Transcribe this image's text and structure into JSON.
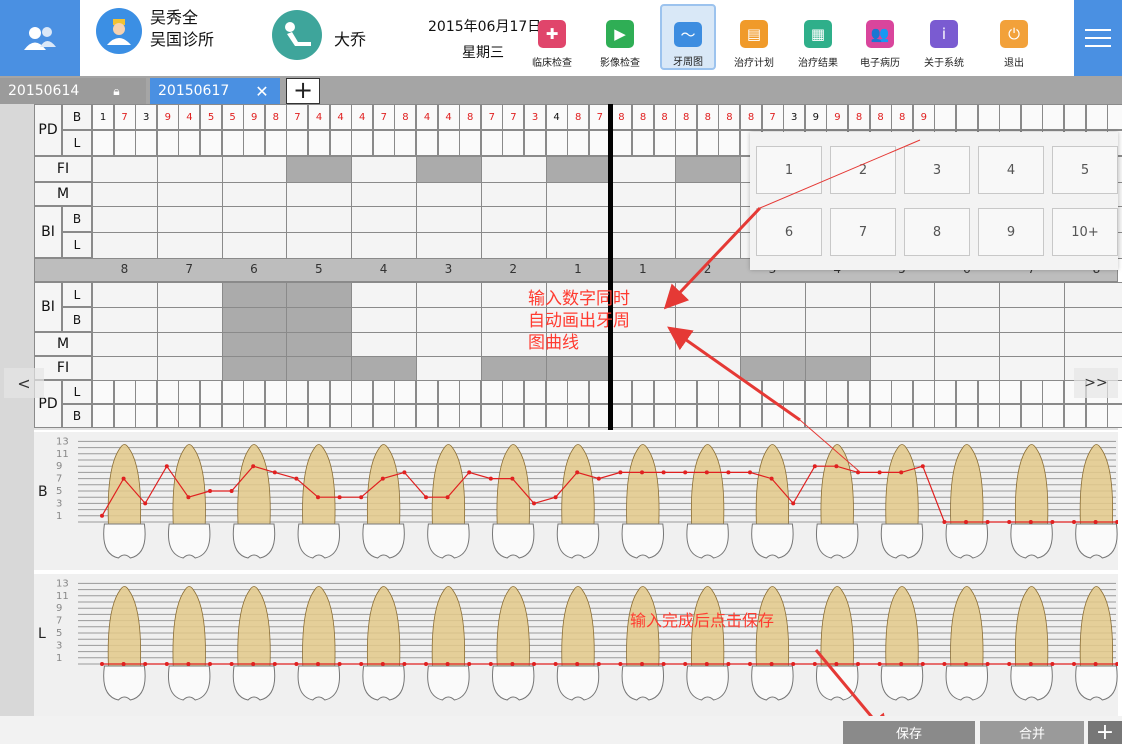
{
  "header": {
    "doctor_name": "吴秀全",
    "clinic_name": "吴国诊所",
    "patient_name": "大乔",
    "date": "2015年06月17日",
    "weekday": "星期三"
  },
  "toolbar": [
    {
      "label": "临床检查",
      "icon": "clinical-exam-icon",
      "color": "#e0456b",
      "glyph": "✚"
    },
    {
      "label": "影像检查",
      "icon": "imaging-icon",
      "color": "#2fae55",
      "glyph": "▶"
    },
    {
      "label": "牙周图",
      "icon": "periodontal-chart-icon",
      "color": "#3d8de0",
      "glyph": "〜",
      "active": true
    },
    {
      "label": "治疗计划",
      "icon": "treatment-plan-icon",
      "color": "#f09a2a",
      "glyph": "▤"
    },
    {
      "label": "治疗结果",
      "icon": "treatment-result-icon",
      "color": "#2faf8a",
      "glyph": "▦"
    },
    {
      "label": "电子病历",
      "icon": "medical-record-icon",
      "color": "#d9459c",
      "glyph": "👥"
    },
    {
      "label": "关于系统",
      "icon": "about-icon",
      "color": "#7a5bd1",
      "glyph": "i"
    },
    {
      "label": "退出",
      "icon": "power-icon",
      "color": "#f2a13a",
      "glyph": "⏻"
    }
  ],
  "tabs": [
    {
      "label": "20150614",
      "locked": true
    },
    {
      "label": "20150617",
      "active": true
    }
  ],
  "add_tab": "+",
  "grid": {
    "upper_labels": {
      "pd": "PD",
      "b": "B",
      "l": "L",
      "fi": "FI",
      "m": "M",
      "bi": "BI"
    },
    "lower_labels": {
      "bi": "BI",
      "l": "L",
      "b": "B",
      "m": "M",
      "fi": "FI",
      "pd": "PD"
    },
    "tooth_numbers": [
      "8",
      "7",
      "6",
      "5",
      "4",
      "3",
      "2",
      "1",
      "1",
      "2",
      "3",
      "4",
      "5",
      "6",
      "7",
      "8"
    ],
    "pd_b_values": [
      "1",
      "7",
      "3",
      "9",
      "4",
      "5",
      "5",
      "9",
      "8",
      "7",
      "4",
      "4",
      "4",
      "7",
      "8",
      "4",
      "4",
      "8",
      "7",
      "7",
      "3",
      "4",
      "8",
      "7",
      "8",
      "8",
      "8",
      "8",
      "8",
      "8",
      "8",
      "7",
      "3",
      "9",
      "9",
      "8",
      "8",
      "8",
      "9"
    ],
    "pd_black_idx": [
      0,
      2,
      21,
      32,
      33
    ]
  },
  "numpad": [
    "1",
    "2",
    "3",
    "4",
    "5",
    "6",
    "7",
    "8",
    "9",
    "10+"
  ],
  "annotations": {
    "input_note_lines": [
      "输入数字同时",
      "自动画出牙周",
      "图曲线"
    ],
    "save_note": "输入完成后点击保存"
  },
  "nav": {
    "prev": "<",
    "next": ">>"
  },
  "chart_data": [
    {
      "type": "line",
      "title": "B",
      "ylabel": "",
      "y_tick_labels": [
        "1",
        "3",
        "5",
        "7",
        "9",
        "11",
        "13"
      ],
      "ylim": [
        0,
        13
      ],
      "categories": [
        "8",
        "7",
        "6",
        "5",
        "4",
        "3",
        "2",
        "1",
        "1",
        "2",
        "3",
        "4",
        "5",
        "6",
        "7",
        "8"
      ],
      "series": [
        {
          "values": [
            1,
            7,
            3,
            9,
            4,
            5,
            5,
            9,
            8,
            7,
            4,
            4,
            4,
            7,
            8,
            4,
            4,
            8,
            7,
            7,
            3,
            4,
            8,
            7,
            8,
            8,
            8,
            8,
            8,
            8,
            8,
            7,
            3,
            9,
            9,
            8,
            8,
            8,
            9,
            0,
            0,
            0,
            0,
            0,
            0,
            0,
            0,
            0
          ]
        }
      ]
    },
    {
      "type": "line",
      "title": "L",
      "ylabel": "",
      "y_tick_labels": [
        "1",
        "3",
        "5",
        "7",
        "9",
        "11",
        "13"
      ],
      "ylim": [
        0,
        13
      ],
      "categories": [
        "8",
        "7",
        "6",
        "5",
        "4",
        "3",
        "2",
        "1",
        "1",
        "2",
        "3",
        "4",
        "5",
        "6",
        "7",
        "8"
      ],
      "series": [
        {
          "values": [
            0,
            0,
            0,
            0,
            0,
            0,
            0,
            0,
            0,
            0,
            0,
            0,
            0,
            0,
            0,
            0,
            0,
            0,
            0,
            0,
            0,
            0,
            0,
            0,
            0,
            0,
            0,
            0,
            0,
            0,
            0,
            0,
            0,
            0,
            0,
            0,
            0,
            0,
            0,
            0,
            0,
            0,
            0,
            0,
            0,
            0,
            0,
            0
          ]
        }
      ]
    }
  ],
  "bottom": {
    "save": "保存",
    "merge": "合并",
    "plus": "+"
  },
  "colors": {
    "accent": "#4a90e2",
    "curve": "#e02020",
    "annotation": "#ff3b30",
    "tooth_root": "#e3c98a"
  }
}
